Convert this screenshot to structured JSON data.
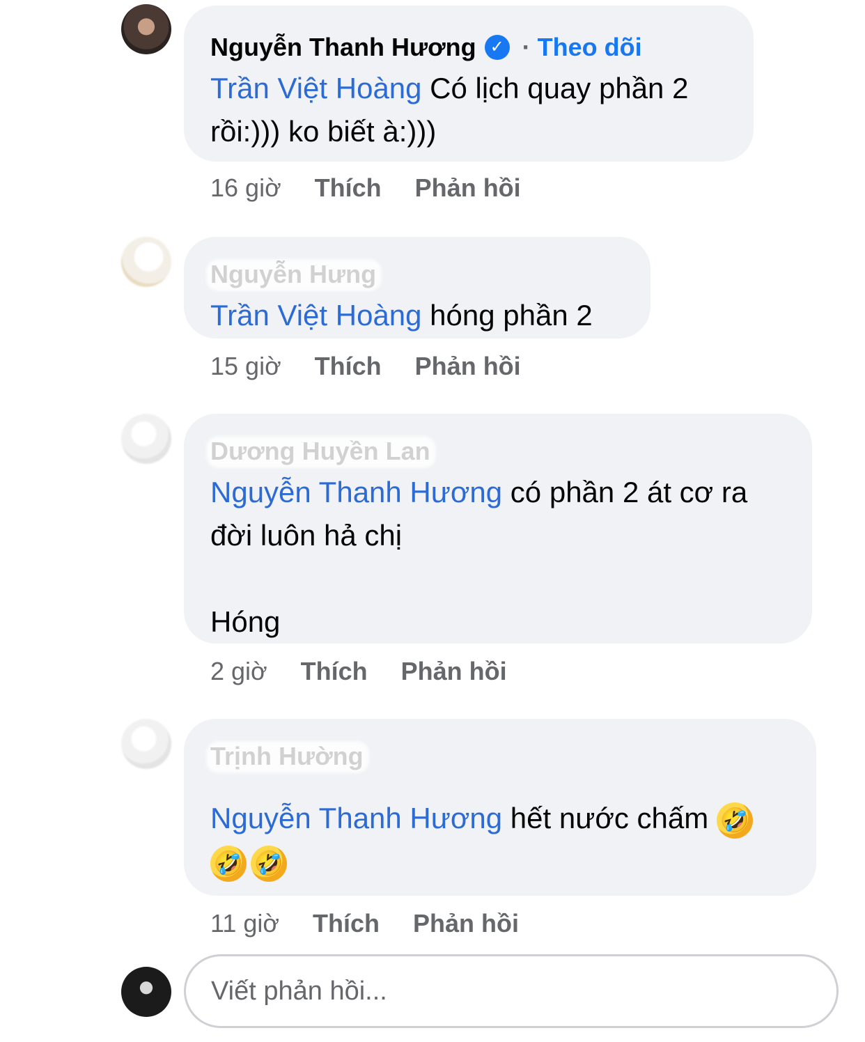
{
  "comments": [
    {
      "author": "Nguyễn Thanh Hương",
      "verified": true,
      "follow_label": "Theo dõi",
      "mention": "Trần Việt Hoàng",
      "text_line1": " Có lịch quay phần 2",
      "text_line2": "rồi:))) ko biết à:)))",
      "time": "16 giờ",
      "like_label": "Thích",
      "reply_label": "Phản hồi"
    },
    {
      "author": "Nguyễn Hưng",
      "mention": "Trần Việt Hoàng",
      "text": " hóng phần 2",
      "time": "15 giờ",
      "like_label": "Thích",
      "reply_label": "Phản hồi"
    },
    {
      "author": "Dương Huyền Lan",
      "mention": "Nguyễn Thanh Hương",
      "text_line1": " có phần 2 át cơ ra",
      "text_line2": "đời luôn hả chị",
      "text_line3": "Hóng",
      "time": "2 giờ",
      "like_label": "Thích",
      "reply_label": "Phản hồi"
    },
    {
      "author": "Trịnh Hường",
      "mention": "Nguyễn Thanh Hương",
      "text": " hết nước chấm",
      "emoji": "🤣",
      "time": "11 giờ",
      "like_label": "Thích",
      "reply_label": "Phản hồi"
    }
  ],
  "reply_input": {
    "placeholder": "Viết phản hồi..."
  },
  "icons": {
    "verified": "verified-badge-icon",
    "emoji": "rolling-on-floor-laughing-emoji"
  },
  "colors": {
    "bubble": "#f0f2f5",
    "mention": "#2d6bd4",
    "follow": "#1877f2",
    "meta": "#65676b"
  }
}
